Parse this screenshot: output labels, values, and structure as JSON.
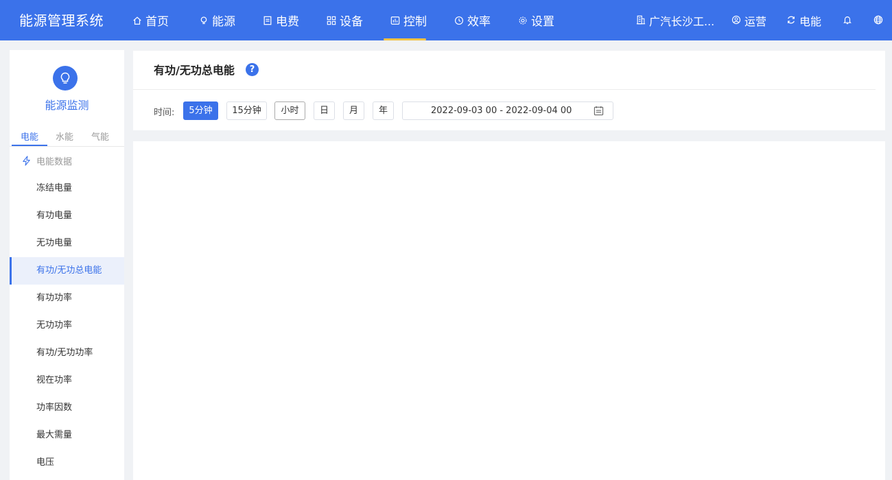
{
  "app": {
    "title": "能源管理系统"
  },
  "nav": {
    "items": [
      {
        "label": "首页",
        "icon": "home-icon"
      },
      {
        "label": "能源",
        "icon": "bulb-icon"
      },
      {
        "label": "电费",
        "icon": "bill-icon"
      },
      {
        "label": "设备",
        "icon": "grid-icon"
      },
      {
        "label": "控制",
        "icon": "chart-icon",
        "active": true
      },
      {
        "label": "效率",
        "icon": "clock-icon"
      },
      {
        "label": "设置",
        "icon": "gear-icon"
      }
    ],
    "right": [
      {
        "label": "广汽长沙工...",
        "icon": "building-icon"
      },
      {
        "label": "运营",
        "icon": "user-icon"
      },
      {
        "label": "电能",
        "icon": "refresh-icon"
      },
      {
        "label": "",
        "icon": "bell-icon"
      },
      {
        "label": "",
        "icon": "globe-icon"
      }
    ],
    "accent_color": "#3b72ea",
    "active_bar_color": "#f6c343"
  },
  "sidebar": {
    "title": "能源监测",
    "tabs": [
      "电能",
      "水能",
      "气能"
    ],
    "active_tab": 0,
    "group_label": "电能数据",
    "items": [
      "冻结电量",
      "有功电量",
      "无功电量",
      "有功/无功总电能",
      "有功功率",
      "无功功率",
      "有功/无功功率",
      "视在功率",
      "功率因数",
      "最大需量",
      "电压"
    ],
    "active_item": 3
  },
  "page": {
    "title": "有功/无功总电能",
    "help": "?",
    "time_label": "时间:",
    "time_buttons": [
      "5分钟",
      "15分钟",
      "小时",
      "日",
      "月",
      "年"
    ],
    "active_time_button": 0,
    "date_range": "2022-09-03 00 - 2022-09-04 00"
  }
}
